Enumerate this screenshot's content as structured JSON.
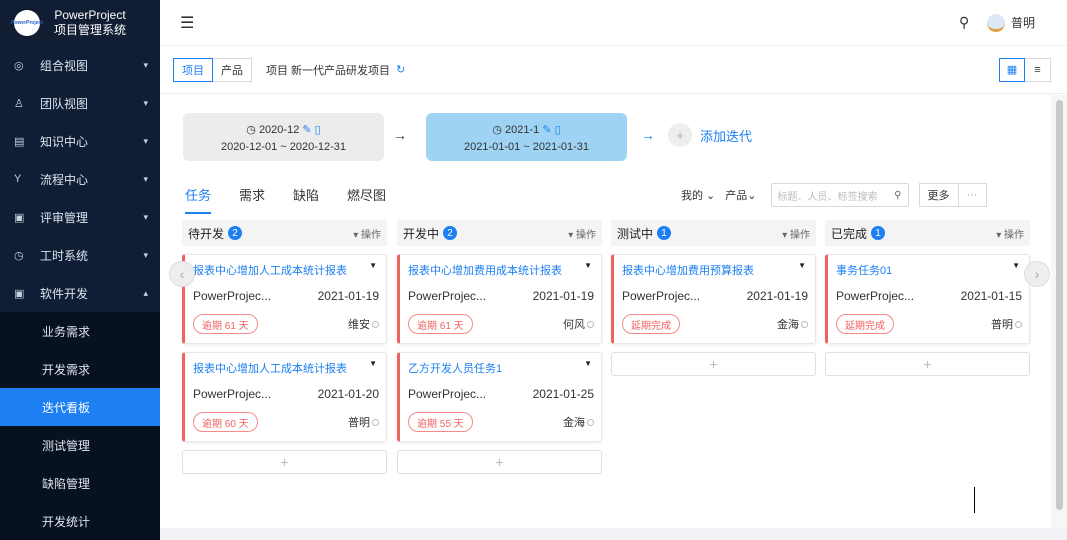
{
  "app": {
    "name": "PowerProject",
    "subtitle": "项目管理系统",
    "logo_text": "PowerProject"
  },
  "sidebar": {
    "items": [
      {
        "label": "组合视图",
        "icon": "dashboard-icon"
      },
      {
        "label": "团队视图",
        "icon": "team-icon"
      },
      {
        "label": "知识中心",
        "icon": "book-icon"
      },
      {
        "label": "流程中心",
        "icon": "flow-icon"
      },
      {
        "label": "评审管理",
        "icon": "review-icon"
      },
      {
        "label": "工时系统",
        "icon": "clock-icon"
      },
      {
        "label": "软件开发",
        "icon": "code-icon"
      }
    ],
    "subitems": [
      {
        "label": "业务需求"
      },
      {
        "label": "开发需求"
      },
      {
        "label": "迭代看板"
      },
      {
        "label": "测试管理"
      },
      {
        "label": "缺陷管理"
      },
      {
        "label": "开发统计"
      }
    ]
  },
  "header": {
    "user": "普明",
    "menu_icon": "menu-fold-icon",
    "search_icon": "search-icon"
  },
  "toolbar": {
    "seg_project": "项目",
    "seg_product": "产品",
    "project_label": "项目 新一代产品研发项目",
    "refresh_icon": "refresh-icon"
  },
  "iterations": [
    {
      "name": "2020-12",
      "range": "2020-12-01 ~ 2020-12-31"
    },
    {
      "name": "2021-1",
      "range": "2021-01-01 ~ 2021-01-31"
    }
  ],
  "add_iteration": "添加迭代",
  "tabs": [
    "任务",
    "需求",
    "缺陷",
    "燃尽图"
  ],
  "filters": {
    "mine": "我的",
    "product": "产品",
    "search_placeholder": "标题、人员、标签搜索",
    "more": "更多",
    "ellipsis": "···"
  },
  "columns": [
    {
      "title": "待开发",
      "count": "2",
      "op": "▾ 操作",
      "cards": [
        {
          "title": "报表中心增加人工成本统计报表",
          "project": "PowerProjec...",
          "date": "2021-01-19",
          "status": "逾期 61 天",
          "owner": "维安"
        },
        {
          "title": "报表中心增加人工成本统计报表",
          "project": "PowerProjec...",
          "date": "2021-01-20",
          "status": "逾期 60 天",
          "owner": "普明"
        }
      ]
    },
    {
      "title": "开发中",
      "count": "2",
      "op": "▾ 操作",
      "cards": [
        {
          "title": "报表中心增加费用成本统计报表",
          "project": "PowerProjec...",
          "date": "2021-01-19",
          "status": "逾期 61 天",
          "owner": "何风"
        },
        {
          "title": "乙方开发人员任务1",
          "project": "PowerProjec...",
          "date": "2021-01-25",
          "status": "逾期 55 天",
          "owner": "金海"
        }
      ]
    },
    {
      "title": "测试中",
      "count": "1",
      "op": "▾ 操作",
      "cards": [
        {
          "title": "报表中心增加费用预算报表",
          "project": "PowerProjec...",
          "date": "2021-01-19",
          "status": "延期完成",
          "owner": "金海"
        }
      ]
    },
    {
      "title": "已完成",
      "count": "1",
      "op": "▾ 操作",
      "cards": [
        {
          "title": "事务任务01",
          "project": "PowerProjec...",
          "date": "2021-01-15",
          "status": "延期完成",
          "owner": "普明"
        }
      ]
    }
  ],
  "colors": {
    "accent": "#1c7ff2",
    "sidebar": "#0f1d35",
    "overdue": "#f06262",
    "iter_active": "#9fd3f4"
  }
}
